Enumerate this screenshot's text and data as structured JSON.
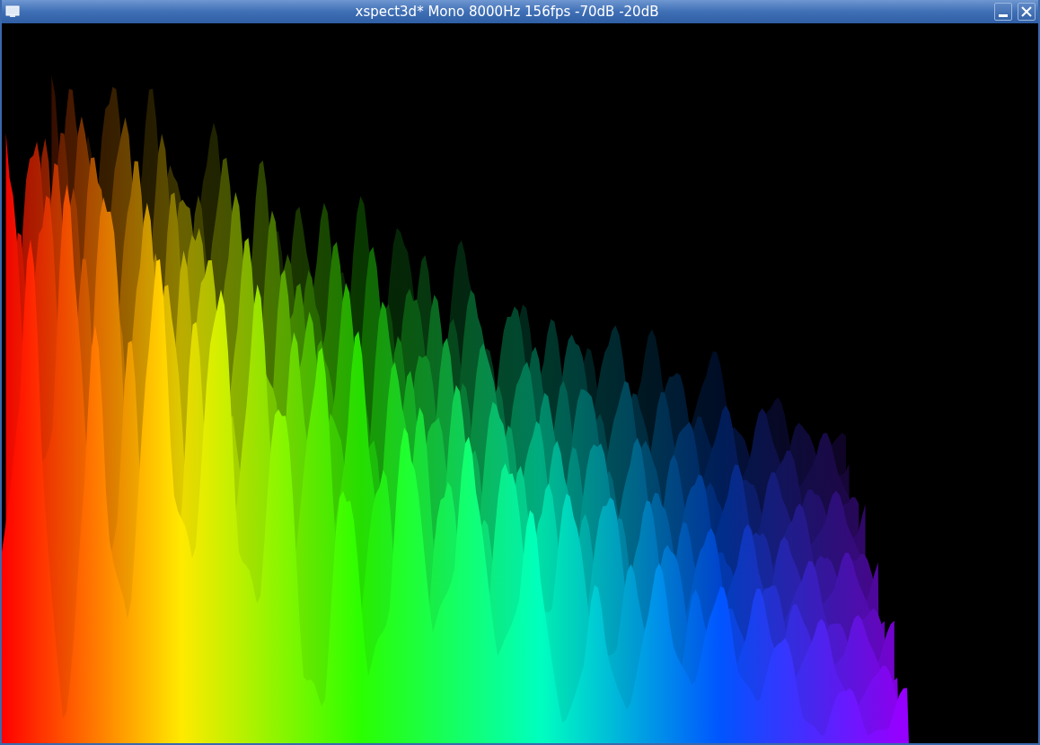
{
  "window": {
    "title": "xspect3d* Mono 8000Hz 156fps -70dB -20dB"
  }
}
